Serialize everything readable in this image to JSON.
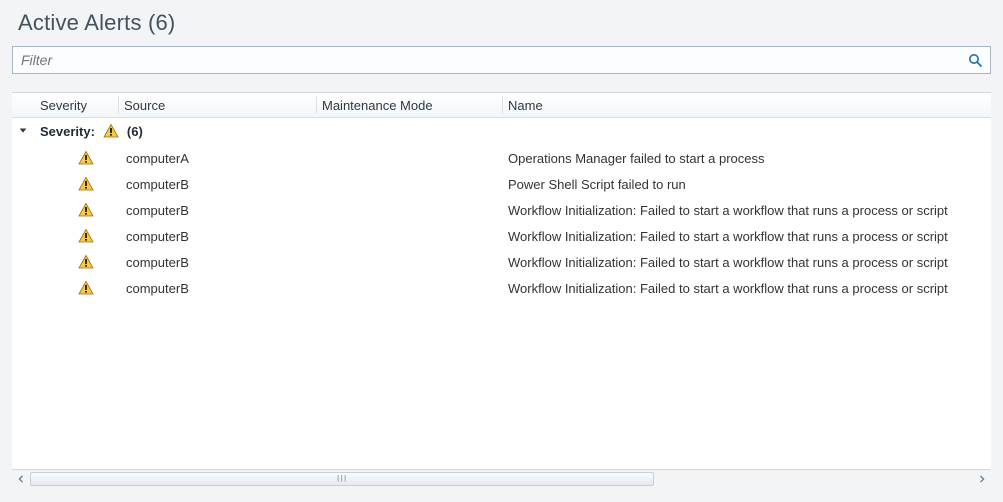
{
  "title": "Active Alerts",
  "title_count": "(6)",
  "filter": {
    "placeholder": "Filter",
    "value": ""
  },
  "columns": {
    "severity": "Severity",
    "source": "Source",
    "maintenance_mode": "Maintenance Mode",
    "name": "Name"
  },
  "group": {
    "label": "Severity:",
    "severity_icon": "warning",
    "count": "(6)"
  },
  "alerts": [
    {
      "severity_icon": "warning",
      "source": "computerA",
      "maintenance_mode": "",
      "name": "Operations Manager failed to start a process"
    },
    {
      "severity_icon": "warning",
      "source": "computerB",
      "maintenance_mode": "",
      "name": "Power Shell Script failed to run"
    },
    {
      "severity_icon": "warning",
      "source": "computerB",
      "maintenance_mode": "",
      "name": "Workflow Initialization: Failed to start a workflow that runs a process or script"
    },
    {
      "severity_icon": "warning",
      "source": "computerB",
      "maintenance_mode": "",
      "name": "Workflow Initialization: Failed to start a workflow that runs a process or script"
    },
    {
      "severity_icon": "warning",
      "source": "computerB",
      "maintenance_mode": "",
      "name": "Workflow Initialization: Failed to start a workflow that runs a process or script"
    },
    {
      "severity_icon": "warning",
      "source": "computerB",
      "maintenance_mode": "",
      "name": "Workflow Initialization: Failed to start a workflow that runs a process or script"
    }
  ],
  "icon_colors": {
    "search_stroke": "#1f6fb2",
    "search_handle": "#1f6fb2",
    "warn_fill": "#f7c948",
    "warn_stroke": "#9c6f00",
    "warn_glyph": "#000000",
    "chev": "#2b3946"
  }
}
